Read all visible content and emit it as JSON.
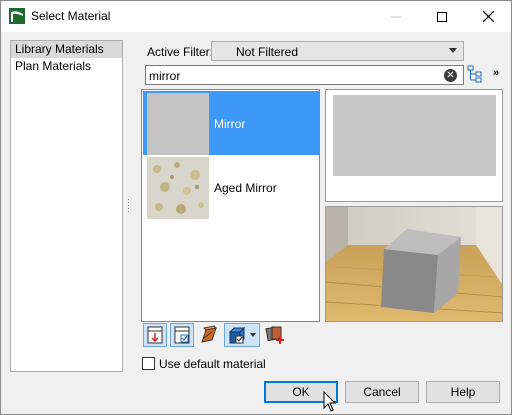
{
  "window": {
    "title": "Select Material"
  },
  "left_panel": {
    "items": [
      {
        "label": "Library Materials",
        "selected": true
      },
      {
        "label": "Plan Materials",
        "selected": false
      }
    ]
  },
  "filter": {
    "label": "Active Filter:",
    "value": "Not Filtered"
  },
  "search": {
    "value": "mirror"
  },
  "materials": [
    {
      "label": "Mirror",
      "selected": true
    },
    {
      "label": "Aged Mirror",
      "selected": false
    }
  ],
  "options": {
    "use_default_label": "Use default material",
    "use_default_checked": false
  },
  "buttons": {
    "ok": "OK",
    "cancel": "Cancel",
    "help": "Help"
  },
  "more_chevron": "»",
  "clear_glyph": "✕",
  "colors": {
    "selection": "#3d98f8",
    "accent": "#0078d7"
  }
}
